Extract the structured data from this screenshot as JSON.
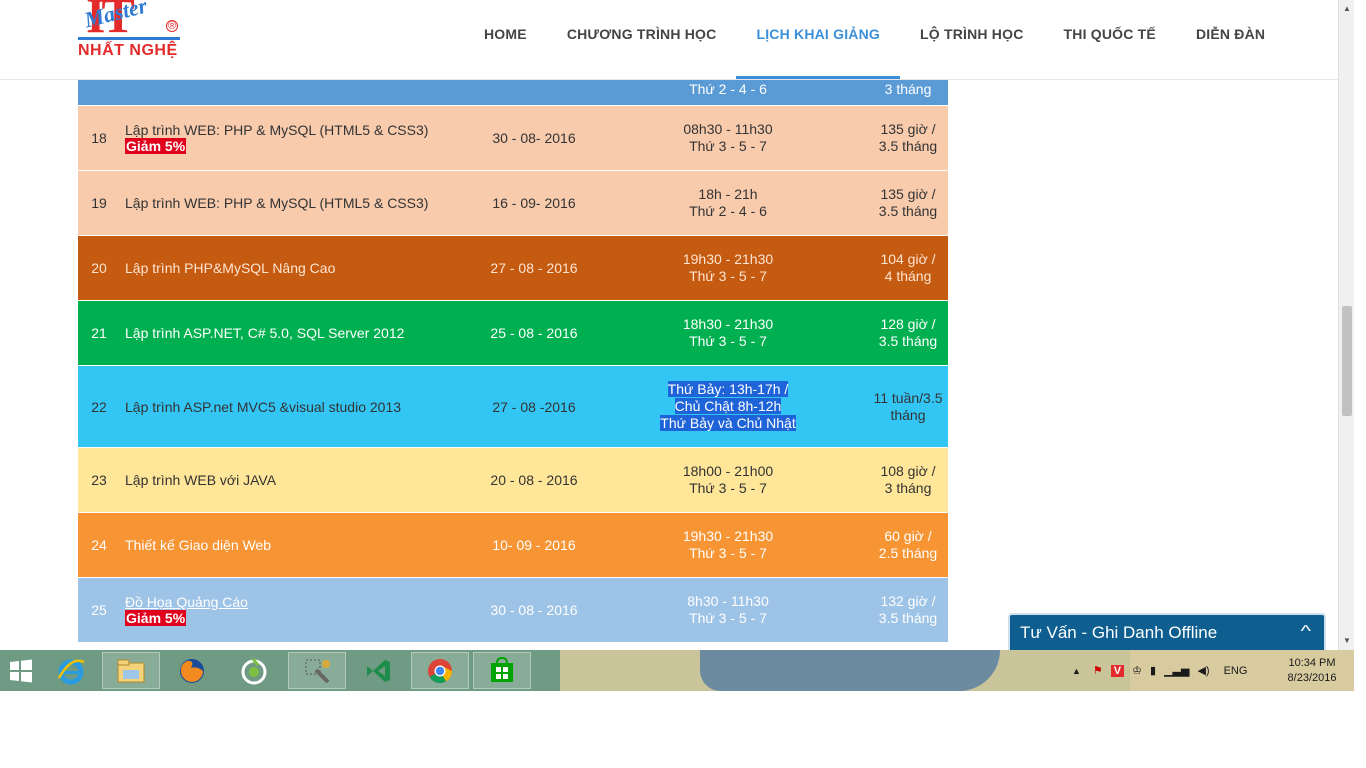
{
  "header": {
    "logo": {
      "it": "IT",
      "master": "Master",
      "reg": "®",
      "name": "NHẤT NGHỆ"
    },
    "nav": [
      {
        "label": "HOME"
      },
      {
        "label": "CHƯƠNG TRÌNH HỌC"
      },
      {
        "label": "LỊCH KHAI GIẢNG",
        "active": true
      },
      {
        "label": "LỘ TRÌNH HỌC"
      },
      {
        "label": "THI QUỐC TẾ"
      },
      {
        "label": "DIỄN ĐÀN"
      }
    ]
  },
  "schedule": {
    "rows": [
      {
        "no": "",
        "course": "",
        "badge": "",
        "date": "",
        "time1": "Thứ 2 - 4 - 6",
        "time2": "",
        "dur1": "3 tháng",
        "dur2": "",
        "color": "#5b9bd5",
        "dark": true
      },
      {
        "no": "18",
        "course": "Lập trình WEB: PHP & MySQL (HTML5 & CSS3)",
        "badge": "Giảm 5%",
        "date": "30 - 08- 2016",
        "time1": "08h30 - 11h30",
        "time2": "Thứ 3 - 5 - 7",
        "dur1": "135 giờ /",
        "dur2": "3.5 tháng",
        "color": "#f8cbad",
        "dark": false
      },
      {
        "no": "19",
        "course": "Lập trình WEB: PHP & MySQL (HTML5 & CSS3)",
        "badge": "",
        "date": "16 - 09- 2016",
        "time1": "18h - 21h",
        "time2": "Thứ 2 - 4 - 6",
        "dur1": "135 giờ /",
        "dur2": "3.5 tháng",
        "color": "#f8cbad",
        "dark": false
      },
      {
        "no": "20",
        "course": "Lập trình PHP&MySQL Nâng Cao",
        "badge": "",
        "date": "27 - 08 - 2016",
        "time1": "19h30 - 21h30",
        "time2": "Thứ 3 - 5 - 7",
        "dur1": "104 giờ /",
        "dur2": "4 tháng",
        "color": "#c55a11",
        "dark": true,
        "textcolor": "#fde4d0"
      },
      {
        "no": "21",
        "course": "Lập trình ASP.NET, C# 5.0, SQL Server 2012",
        "badge": "",
        "date": "25 - 08 - 2016",
        "time1": "18h30 - 21h30",
        "time2": "Thứ 3 - 5 - 7",
        "dur1": "128 giờ /",
        "dur2": "3.5 tháng",
        "color": "#00b050",
        "dark": true
      },
      {
        "no": "22",
        "course": "Lập trình ASP.net MVC5 &visual studio 2013",
        "badge": "",
        "date": "27 - 08 -2016",
        "time1": "Thứ Bảy: 13h-17h /",
        "time2": "Chủ Chật 8h-12h",
        "time3": "Thứ Bảy và Chủ Nhật",
        "dur1": "11 tuần/3.5",
        "dur2": "tháng",
        "color": "#33c6f4",
        "dark": false,
        "selected": true
      },
      {
        "no": "23",
        "course": "Lập trình WEB với JAVA",
        "badge": "",
        "date": "20 - 08 - 2016",
        "time1": "18h00 - 21h00",
        "time2": "Thứ 3 - 5 - 7",
        "dur1": "108 giờ /",
        "dur2": "3 tháng",
        "color": "#ffe699",
        "dark": false
      },
      {
        "no": "24",
        "course": "Thiết kế Giao diện Web",
        "badge": "",
        "date": "10- 09 - 2016",
        "time1": "19h30 - 21h30",
        "time2": "Thứ 3 - 5 - 7",
        "dur1": "60 giờ /",
        "dur2": "2.5 tháng",
        "color": "#f79433",
        "dark": true
      },
      {
        "no": "25",
        "course": "Đồ Họa Quảng Cáo",
        "badge": "Giảm 5%",
        "date": "30 - 08 - 2016",
        "time1": "8h30 - 11h30",
        "time2": "Thứ 3 - 5 - 7",
        "dur1": "132 giờ /",
        "dur2": "3.5 tháng",
        "color": "#9dc3e6",
        "dark": true
      }
    ]
  },
  "chat": {
    "label": "Tư Vấn - Ghi Danh Offline"
  },
  "taskbar": {
    "apps": [
      "start-icon",
      "ie-icon",
      "file-explorer-icon",
      "firefox-icon",
      "coccoc-icon",
      "tools-icon",
      "visual-studio-icon",
      "chrome-icon",
      "store-icon"
    ],
    "language": "ENG",
    "time": "10:34 PM",
    "date": "8/23/2016"
  },
  "colors": {
    "accent": "#3a8fd8",
    "brand_red": "#e32b2b",
    "chat_bg": "#0e5f8f"
  }
}
